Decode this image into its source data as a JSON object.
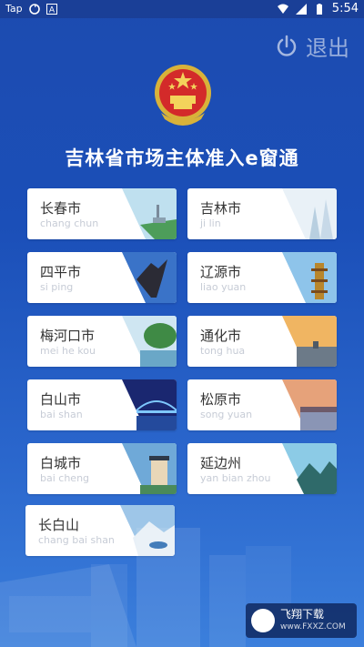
{
  "status_bar": {
    "left_text": "Tap",
    "time": "5:54"
  },
  "header": {
    "logout_label": "退出",
    "app_title": "吉林省市场主体准入e窗通"
  },
  "cities": [
    {
      "name": "长春市",
      "pinyin": "chang chun"
    },
    {
      "name": "吉林市",
      "pinyin": "ji lin"
    },
    {
      "name": "四平市",
      "pinyin": "si ping"
    },
    {
      "name": "辽源市",
      "pinyin": "liao yuan"
    },
    {
      "name": "梅河口市",
      "pinyin": "mei he kou"
    },
    {
      "name": "通化市",
      "pinyin": "tong hua"
    },
    {
      "name": "白山市",
      "pinyin": "bai shan"
    },
    {
      "name": "松原市",
      "pinyin": "song yuan"
    },
    {
      "name": "白城市",
      "pinyin": "bai cheng"
    },
    {
      "name": "延边州",
      "pinyin": "yan bian zhou"
    },
    {
      "name": "长白山",
      "pinyin": "chang bai shan"
    }
  ],
  "watermark": {
    "title": "飞翔下载",
    "url": "www.FXXZ.COM"
  },
  "colors": {
    "background": "#1c4bb0",
    "status_bar": "#1a3f97",
    "card_bg": "#ffffff",
    "city_text": "#333333",
    "pinyin_text": "#c7ccd6"
  }
}
